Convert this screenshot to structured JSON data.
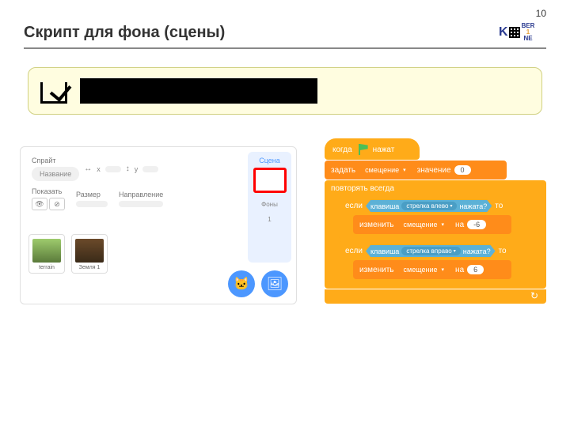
{
  "page_number": "10",
  "title": "Скрипт для фона (сцены)",
  "logo": {
    "k": "K",
    "ber": "BER",
    "one": "1",
    "o": "O",
    "ne": "NE"
  },
  "sprite_panel": {
    "sprite_label": "Спрайт",
    "name_placeholder": "Название",
    "x_label": "x",
    "y_label": "y",
    "show_label": "Показать",
    "size_label": "Размер",
    "direction_label": "Направление",
    "thumbs": [
      {
        "name": "terrain"
      },
      {
        "name": "Земля 1"
      }
    ],
    "stage_label": "Сцена",
    "bgs_label": "Фоны",
    "bgs_count": "1"
  },
  "script": {
    "hat_when": "когда",
    "hat_clicked": "нажат",
    "set_label": "задать",
    "set_var": "смещение",
    "set_value_word": "значение",
    "set_value": "0",
    "forever": "повторять всегда",
    "if_word": "если",
    "then_word": "то",
    "key_word": "клавиша",
    "pressed_word": "нажата?",
    "key_left": "стрелка влево",
    "key_right": "стрелка вправо",
    "change_label": "изменить",
    "change_var": "смещение",
    "by_word": "на",
    "change_left": "-6",
    "change_right": "6"
  }
}
